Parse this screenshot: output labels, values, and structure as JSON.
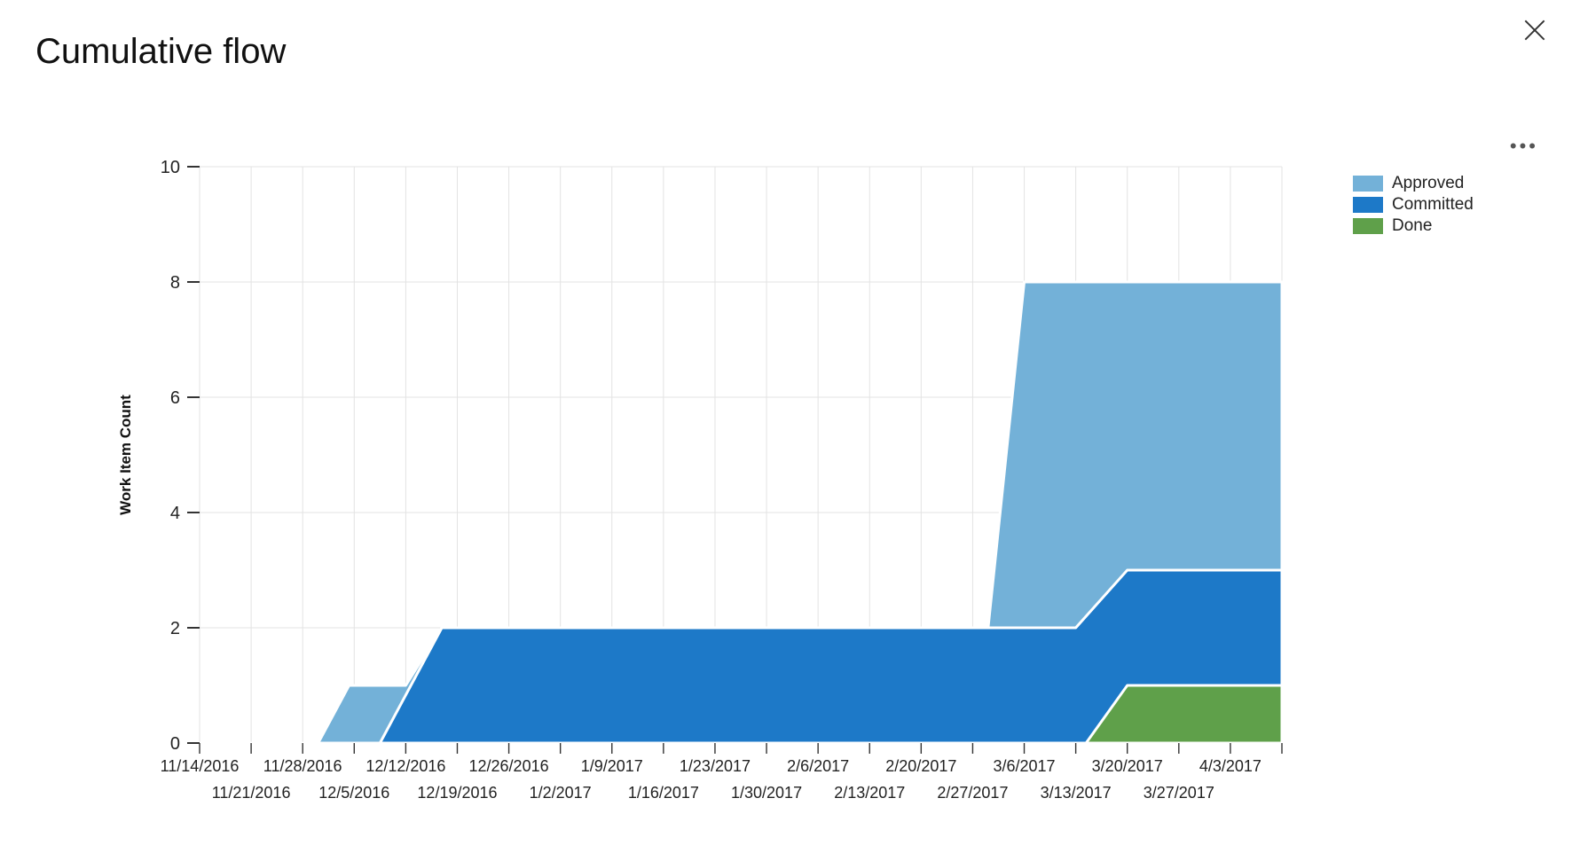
{
  "title": "Cumulative flow",
  "legend": {
    "items": [
      {
        "label": "Approved",
        "color": "#73b1d8"
      },
      {
        "label": "Committed",
        "color": "#1d79c8"
      },
      {
        "label": "Done",
        "color": "#5fa04a"
      }
    ]
  },
  "chart_data": {
    "type": "area",
    "title": "Cumulative flow",
    "xlabel": "",
    "ylabel": "Work Item Count",
    "ylim": [
      0,
      10
    ],
    "yticks": [
      0,
      2,
      4,
      6,
      8,
      10
    ],
    "x_ticks_row1": [
      "11/14/2016",
      "11/28/2016",
      "12/12/2016",
      "12/26/2016",
      "1/9/2017",
      "1/23/2017",
      "2/6/2017",
      "2/20/2017",
      "3/6/2017",
      "3/20/2017",
      "4/3/2017"
    ],
    "x_ticks_row2": [
      "11/21/2016",
      "12/5/2016",
      "12/19/2016",
      "1/2/2017",
      "1/16/2017",
      "1/30/2017",
      "2/13/2017",
      "2/27/2017",
      "3/13/2017",
      "3/27/2017"
    ],
    "x_index_range": [
      0,
      21
    ],
    "series": [
      {
        "name": "Done",
        "color": "#5fa04a",
        "points": [
          [
            0,
            0
          ],
          [
            17.2,
            0
          ],
          [
            18,
            1
          ],
          [
            21,
            1
          ]
        ]
      },
      {
        "name": "Committed",
        "color": "#1d79c8",
        "points": [
          [
            0,
            0
          ],
          [
            3.5,
            0
          ],
          [
            4.7,
            2
          ],
          [
            17,
            2
          ],
          [
            18,
            3
          ],
          [
            21,
            3
          ]
        ]
      },
      {
        "name": "Approved",
        "color": "#73b1d8",
        "points": [
          [
            0,
            0
          ],
          [
            2.3,
            0
          ],
          [
            2.9,
            1
          ],
          [
            4.0,
            1
          ],
          [
            4.7,
            2
          ],
          [
            15.3,
            2
          ],
          [
            16,
            8
          ],
          [
            21,
            8
          ]
        ]
      }
    ],
    "legend_position": "right",
    "grid": true
  }
}
